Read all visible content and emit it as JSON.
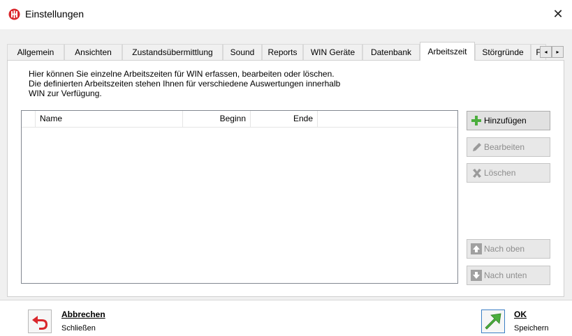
{
  "window": {
    "title": "Einstellungen",
    "icon": "app-logo-icon",
    "close": "✕"
  },
  "tabs": [
    {
      "label": "Allgemein",
      "active": false
    },
    {
      "label": "Ansichten",
      "active": false
    },
    {
      "label": "Zustandsübermittlung",
      "active": false
    },
    {
      "label": "Sound",
      "active": false
    },
    {
      "label": "Reports",
      "active": false
    },
    {
      "label": "WIN Geräte",
      "active": false
    },
    {
      "label": "Datenbank",
      "active": false
    },
    {
      "label": "Arbeitszeit",
      "active": true
    },
    {
      "label": "Störgründe",
      "active": false
    },
    {
      "label": "F",
      "active": false
    }
  ],
  "tab_scroll": {
    "left": "◂",
    "right": "▸"
  },
  "panel": {
    "description_lines": [
      "Hier können Sie einzelne Arbeitszeiten für WIN erfassen, bearbeiten oder löschen.",
      "Die definierten Arbeitszeiten stehen Ihnen für verschiedene Auswertungen innerhalb",
      "WIN zur Verfügung."
    ],
    "table": {
      "columns": [
        "",
        "Name",
        "Beginn",
        "Ende",
        ""
      ],
      "rows": []
    },
    "buttons": {
      "add": {
        "label": "Hinzufügen",
        "enabled": true,
        "icon": "plus-icon"
      },
      "edit": {
        "label": "Bearbeiten",
        "enabled": false,
        "icon": "pencil-icon"
      },
      "delete": {
        "label": "Löschen",
        "enabled": false,
        "icon": "delete-x-icon"
      },
      "up": {
        "label": "Nach oben",
        "enabled": false,
        "icon": "arrow-up-icon"
      },
      "down": {
        "label": "Nach unten",
        "enabled": false,
        "icon": "arrow-down-icon"
      }
    }
  },
  "footer": {
    "cancel": {
      "title": "Abbrechen",
      "subtitle": "Schließen",
      "icon": "undo-arrow-icon"
    },
    "ok": {
      "title": "OK",
      "subtitle": "Speichern",
      "icon": "green-arrow-icon"
    }
  },
  "colors": {
    "accent_red": "#d9262b",
    "accent_green": "#4cae3e",
    "panel_bg": "#f0f0f0"
  }
}
